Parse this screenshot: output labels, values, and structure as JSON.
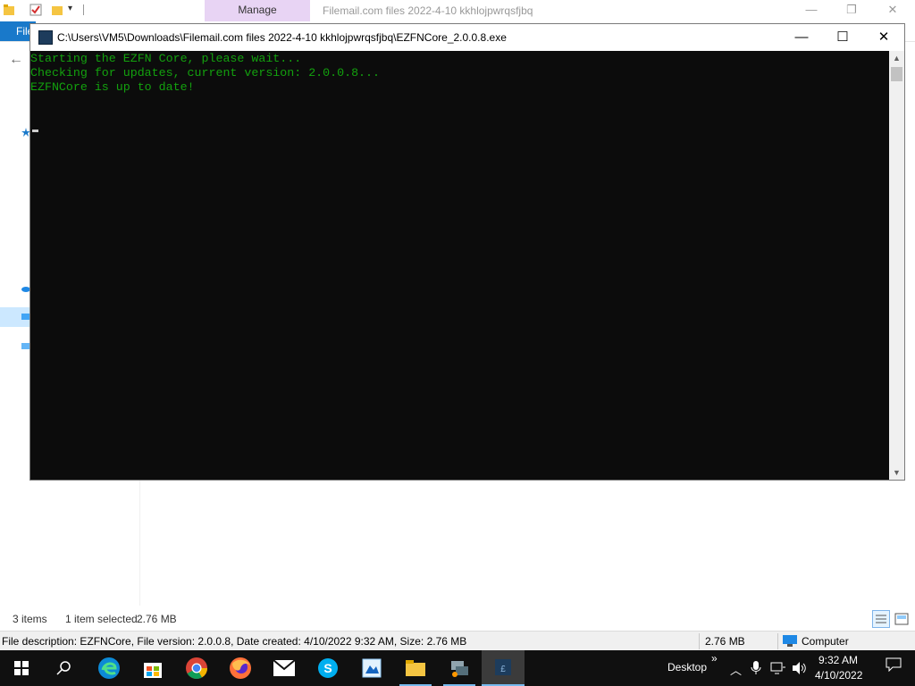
{
  "explorer": {
    "manage_tab": "Manage",
    "title": "Filemail.com files 2022-4-10 kkhlojpwrqsfjbq",
    "file_tab": "File",
    "status": {
      "items": "3 items",
      "selected": "1 item selected",
      "selected_size": "2.76 MB"
    },
    "infobar": {
      "description": "File description: EZFNCore, File version: 2.0.0.8, Date created: 4/10/2022 9:32 AM, Size: 2.76 MB",
      "size": "2.76 MB",
      "location": "Computer"
    }
  },
  "console": {
    "title": "C:\\Users\\VM5\\Downloads\\Filemail.com files 2022-4-10 kkhlojpwrqsfjbq\\EZFNCore_2.0.0.8.exe",
    "lines": [
      "Starting the EZFN Core, please wait...",
      "Checking for updates, current version: 2.0.0.8...",
      "EZFNCore is up to date!"
    ],
    "text_color": "#13a10e",
    "background": "#0c0c0c"
  },
  "taskbar": {
    "apps": [
      "start-icon",
      "search-icon",
      "edge-icon",
      "store-icon",
      "chrome-icon",
      "firefox-icon",
      "mail-icon",
      "skype-icon",
      "paint-icon",
      "file-explorer-icon",
      "network-tool-icon",
      "console-app-icon"
    ],
    "desktop_label": "Desktop",
    "time": "9:32 AM",
    "date": "4/10/2022",
    "accent": "#76b9ed"
  }
}
